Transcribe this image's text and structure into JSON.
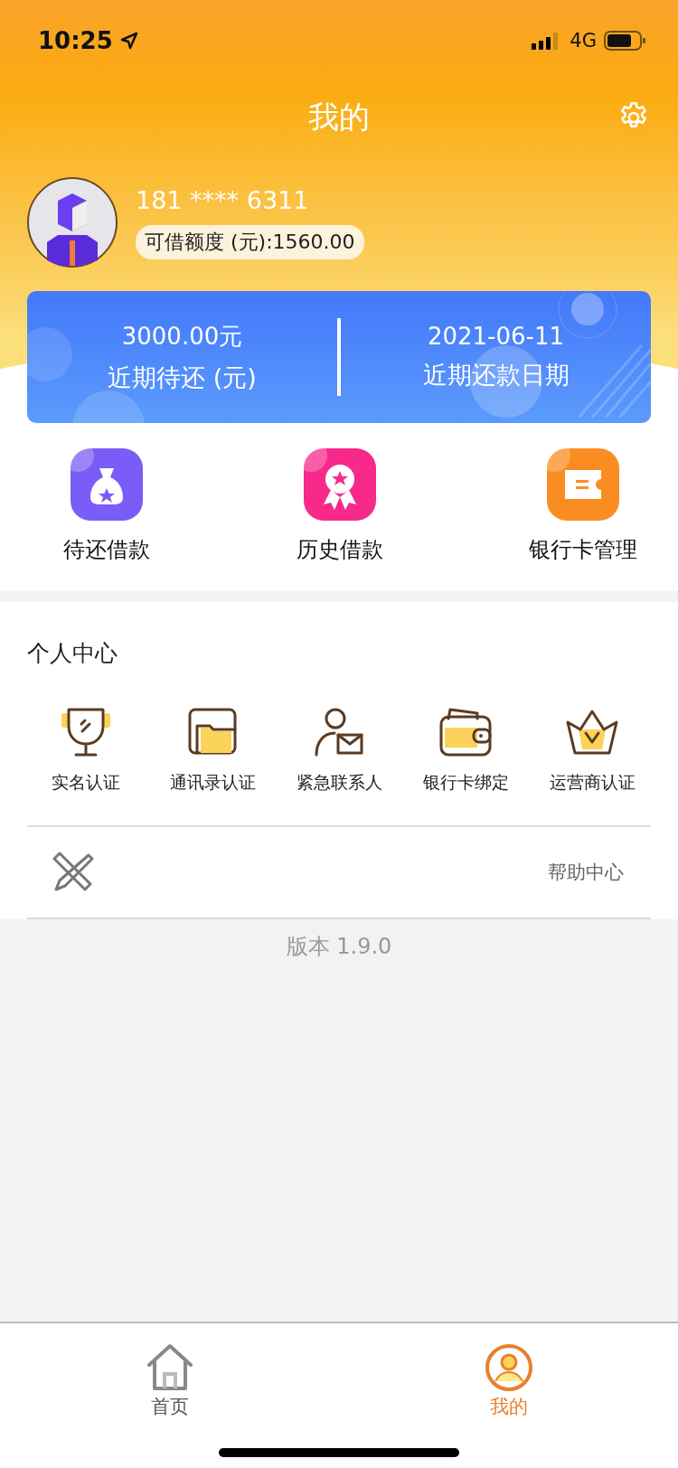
{
  "status_bar": {
    "time": "10:25",
    "network": "4G"
  },
  "title": "我的",
  "profile": {
    "phone": "181 **** 6311",
    "credit": "可借额度 (元):1560.00"
  },
  "summary": [
    {
      "value": "3000.00元",
      "label": "近期待还 (元)"
    },
    {
      "value": "2021-06-11",
      "label": "近期还款日期"
    }
  ],
  "quick_actions": [
    {
      "label": "待还借款",
      "kind": "bag"
    },
    {
      "label": "历史借款",
      "kind": "medal"
    },
    {
      "label": "银行卡管理",
      "kind": "card"
    }
  ],
  "personal_center": {
    "title": "个人中心",
    "items": [
      {
        "label": "实名认证",
        "kind": "trophy"
      },
      {
        "label": "通讯录认证",
        "kind": "folder"
      },
      {
        "label": "紧急联系人",
        "kind": "contact"
      },
      {
        "label": "银行卡绑定",
        "kind": "wallet"
      },
      {
        "label": "运营商认证",
        "kind": "crown"
      }
    ]
  },
  "help": {
    "label": "帮助中心"
  },
  "version": "版本 1.9.0",
  "tabs": [
    {
      "label": "首页",
      "kind": "home",
      "selected": false
    },
    {
      "label": "我的",
      "kind": "profile",
      "selected": true
    }
  ]
}
